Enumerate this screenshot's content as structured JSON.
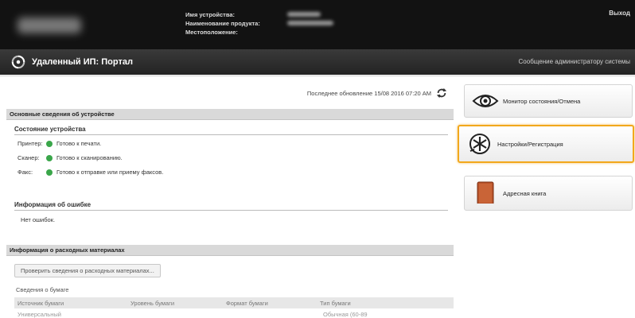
{
  "header": {
    "device_name_label": "Имя устройства:",
    "product_name_label": "Наименование продукта:",
    "location_label": "Местоположение:",
    "logout_label": "Выход"
  },
  "portal": {
    "title": "Удаленный ИП: Портал",
    "admin_message_label": "Сообщение администратору системы"
  },
  "main": {
    "last_update": "Последнее обновление 15/08 2016 07:20 AM",
    "basic_info_title": "Основные сведения об устройстве",
    "device_status_title": "Состояние устройства",
    "status_rows": [
      {
        "label": "Принтер:",
        "value": "Готово к печати."
      },
      {
        "label": "Сканер:",
        "value": "Готово к сканированию."
      },
      {
        "label": "Факс:",
        "value": "Готово к отправке или приему факсов."
      }
    ],
    "error_info_title": "Информация об ошибке",
    "no_errors": "Нет ошибок.",
    "consumables_title": "Информация о расходных материалах",
    "check_consumables_button": "Проверить сведения о расходных материалах...",
    "paper_info_title": "Сведения о бумаге",
    "paper_table_headers": [
      "Источник бумаги",
      "Уровень бумаги",
      "Формат бумаги",
      "Тип бумаги"
    ],
    "paper_row": {
      "source": "Универсальный",
      "type": "Обычная (60-89"
    }
  },
  "menu": {
    "items": [
      {
        "label": "Монитор состояния/Отмена",
        "icon": "eye-icon"
      },
      {
        "label": "Настройки/Регистрация",
        "icon": "settings-star-icon"
      },
      {
        "label": "Адресная книга",
        "icon": "address-book-icon"
      }
    ]
  },
  "colors": {
    "status_ok": "#3aa64a",
    "highlight": "#f2a81c",
    "topbar": "#121212"
  }
}
